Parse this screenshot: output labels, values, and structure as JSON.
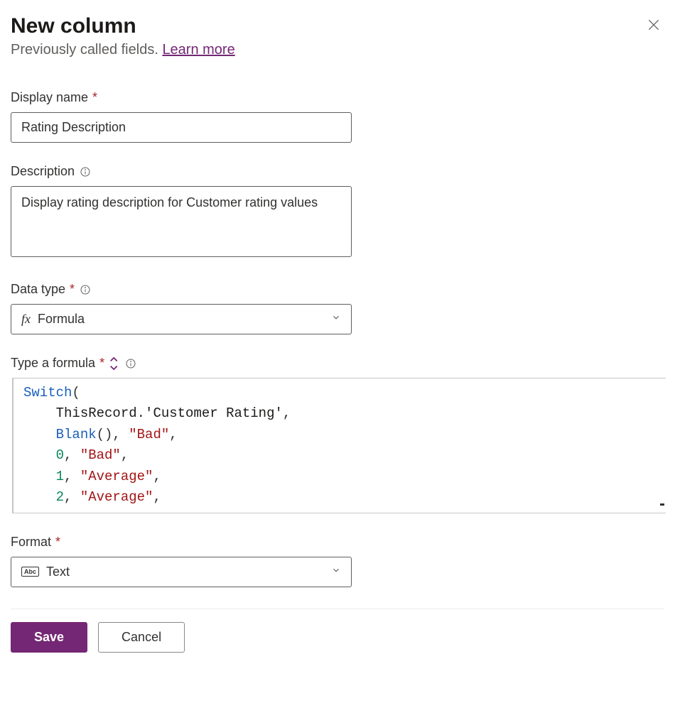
{
  "header": {
    "title": "New column",
    "subtitle_prefix": "Previously called fields. ",
    "learn_more": "Learn more"
  },
  "displayName": {
    "label": "Display name",
    "value": "Rating Description"
  },
  "description": {
    "label": "Description",
    "value": "Display rating description for Customer rating values"
  },
  "dataType": {
    "label": "Data type",
    "icon": "fx",
    "value": "Formula"
  },
  "formula": {
    "label": "Type a formula",
    "tokens": {
      "switch": "Switch",
      "this": "ThisRecord",
      "field": "'Customer Rating'",
      "blank": "Blank",
      "bad": "\"Bad\"",
      "avg": "\"Average\"",
      "n0": "0",
      "n1": "1",
      "n2": "2"
    }
  },
  "format": {
    "label": "Format",
    "icon": "Abc",
    "value": "Text"
  },
  "buttons": {
    "save": "Save",
    "cancel": "Cancel"
  }
}
